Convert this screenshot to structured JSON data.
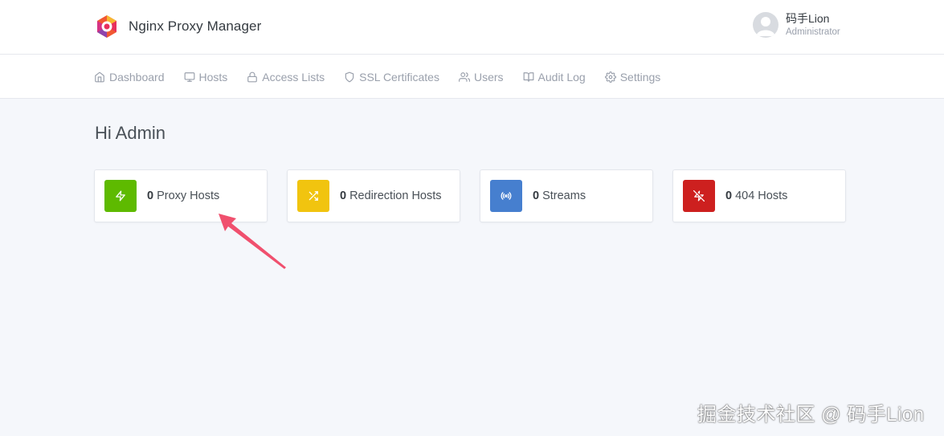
{
  "header": {
    "title": "Nginx Proxy Manager",
    "user": {
      "name": "码手Lion",
      "role": "Administrator"
    }
  },
  "nav": [
    {
      "label": "Dashboard",
      "icon": "home-icon"
    },
    {
      "label": "Hosts",
      "icon": "monitor-icon"
    },
    {
      "label": "Access Lists",
      "icon": "lock-icon"
    },
    {
      "label": "SSL Certificates",
      "icon": "shield-icon"
    },
    {
      "label": "Users",
      "icon": "users-icon"
    },
    {
      "label": "Audit Log",
      "icon": "book-icon"
    },
    {
      "label": "Settings",
      "icon": "gear-icon"
    }
  ],
  "main": {
    "greeting": "Hi Admin",
    "cards": [
      {
        "count": "0",
        "label": "Proxy Hosts",
        "icon": "zap-icon",
        "color": "#5eba00"
      },
      {
        "count": "0",
        "label": "Redirection Hosts",
        "icon": "shuffle-icon",
        "color": "#f1c40f"
      },
      {
        "count": "0",
        "label": "Streams",
        "icon": "radio-icon",
        "color": "#467fcf"
      },
      {
        "count": "0",
        "label": "404 Hosts",
        "icon": "zap-off-icon",
        "color": "#cd201f"
      }
    ]
  },
  "annotation": {
    "arrow_color": "#f0506e"
  },
  "watermark": "掘金技术社区 @ 码手Lion"
}
